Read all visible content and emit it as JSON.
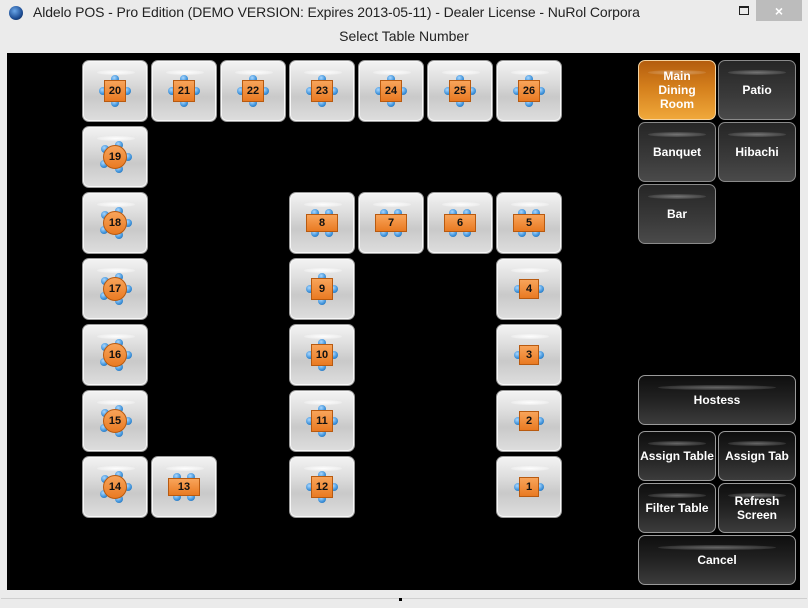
{
  "window": {
    "title": "Aldelo POS - Pro Edition (DEMO VERSION: Expires 2013-05-11)  - Dealer License - NuRol Corpora",
    "icon": "app-globe-icon",
    "controls": {
      "minimize": "minimize-icon",
      "maximize": "maximize-icon",
      "close": "×"
    }
  },
  "header": {
    "subtitle": "Select Table Number"
  },
  "accent_colors": {
    "selected_area": "#e0902a",
    "table_top": "#f08a35",
    "chair": "#3a8fd8",
    "background": "#000000"
  },
  "tables": [
    {
      "number": "20",
      "shape": "square4",
      "col": 0,
      "row": 0
    },
    {
      "number": "21",
      "shape": "square4",
      "col": 1,
      "row": 0
    },
    {
      "number": "22",
      "shape": "square4",
      "col": 2,
      "row": 0
    },
    {
      "number": "23",
      "shape": "square4",
      "col": 3,
      "row": 0
    },
    {
      "number": "24",
      "shape": "square4",
      "col": 4,
      "row": 0
    },
    {
      "number": "25",
      "shape": "square4",
      "col": 5,
      "row": 0
    },
    {
      "number": "26",
      "shape": "square4",
      "col": 6,
      "row": 0
    },
    {
      "number": "19",
      "shape": "round5",
      "col": 0,
      "row": 1
    },
    {
      "number": "18",
      "shape": "round5",
      "col": 0,
      "row": 2
    },
    {
      "number": "8",
      "shape": "rect4",
      "col": 3,
      "row": 2
    },
    {
      "number": "7",
      "shape": "rect4",
      "col": 4,
      "row": 2
    },
    {
      "number": "6",
      "shape": "rect4",
      "col": 5,
      "row": 2
    },
    {
      "number": "5",
      "shape": "rect4",
      "col": 6,
      "row": 2
    },
    {
      "number": "17",
      "shape": "round5",
      "col": 0,
      "row": 3
    },
    {
      "number": "9",
      "shape": "square4",
      "col": 3,
      "row": 3
    },
    {
      "number": "4",
      "shape": "square2",
      "col": 6,
      "row": 3
    },
    {
      "number": "16",
      "shape": "round5",
      "col": 0,
      "row": 4
    },
    {
      "number": "10",
      "shape": "square4",
      "col": 3,
      "row": 4
    },
    {
      "number": "3",
      "shape": "square2",
      "col": 6,
      "row": 4
    },
    {
      "number": "15",
      "shape": "round5",
      "col": 0,
      "row": 5
    },
    {
      "number": "11",
      "shape": "square4",
      "col": 3,
      "row": 5
    },
    {
      "number": "2",
      "shape": "square2",
      "col": 6,
      "row": 5
    },
    {
      "number": "14",
      "shape": "round5",
      "col": 0,
      "row": 6
    },
    {
      "number": "13",
      "shape": "rect4",
      "col": 1,
      "row": 6
    },
    {
      "number": "12",
      "shape": "square4",
      "col": 3,
      "row": 6
    },
    {
      "number": "1",
      "shape": "square2",
      "col": 6,
      "row": 6
    }
  ],
  "areas": [
    {
      "label": "Main Dining Room",
      "selected": true
    },
    {
      "label": "Patio",
      "selected": false
    },
    {
      "label": "Banquet",
      "selected": false
    },
    {
      "label": "Hibachi",
      "selected": false
    },
    {
      "label": "Bar",
      "selected": false
    }
  ],
  "actions": {
    "hostess": "Hostess",
    "assign_table": "Assign Table",
    "assign_tab": "Assign Tab",
    "filter_table": "Filter Table",
    "refresh_screen": "Refresh Screen",
    "cancel": "Cancel"
  }
}
